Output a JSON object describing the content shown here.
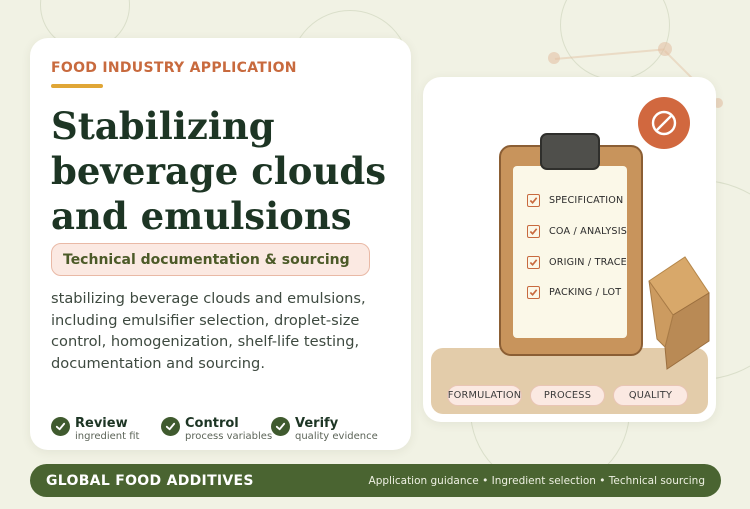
{
  "hero": {
    "eyebrow": "FOOD INDUSTRY APPLICATION",
    "title_lines": [
      "Stabilizing",
      "beverage clouds",
      "and emulsions"
    ],
    "subtitle": "Technical documentation & sourcing",
    "description": "stabilizing beverage clouds and emulsions, including emulsifier selection, droplet-size control, homogenization, shelf-life testing, documentation and sourcing."
  },
  "badges": [
    {
      "title": "Review",
      "subtitle": "ingredient fit",
      "icon": "check-icon"
    },
    {
      "title": "Control",
      "subtitle": "process variables",
      "icon": "check-icon"
    },
    {
      "title": "Verify",
      "subtitle": "quality evidence",
      "icon": "check-icon"
    }
  ],
  "illustration": {
    "checklist": [
      "SPECIFICATION",
      "COA / ANALYSIS",
      "ORIGIN / TRACE",
      "PACKING / LOT"
    ],
    "tags": [
      "FORMULATION",
      "PROCESS",
      "QUALITY"
    ],
    "badge_icon": "prohibited-icon",
    "box_icon": "box-icon"
  },
  "footer": {
    "brand": "GLOBAL FOOD ADDITIVES",
    "tagline": "Application guidance • Ingredient selection • Technical sourcing"
  },
  "colors": {
    "background": "#f1f2e4",
    "accent_orange": "#c86a3e",
    "accent_yellow": "#e0a636",
    "dark_green": "#1d3524",
    "brand_green": "#4a6431"
  }
}
